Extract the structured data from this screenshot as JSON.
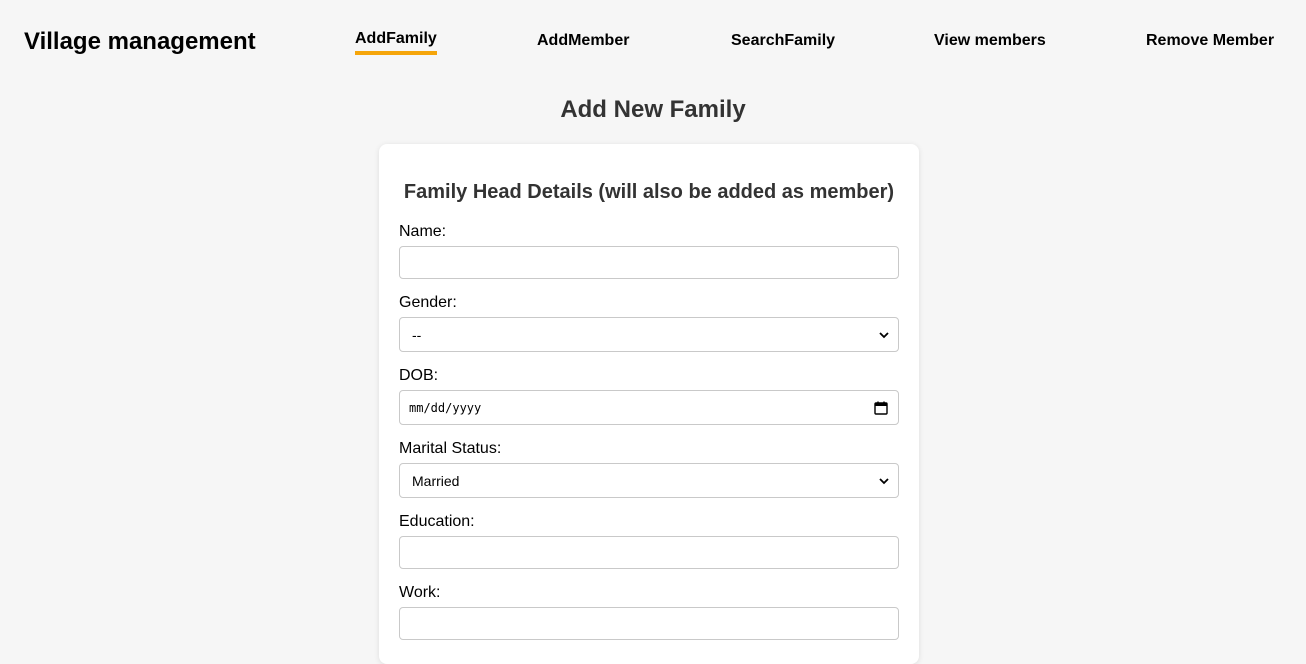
{
  "header": {
    "brand": "Village management",
    "nav": [
      {
        "label": "AddFamily",
        "active": true
      },
      {
        "label": "AddMember",
        "active": false
      },
      {
        "label": "SearchFamily",
        "active": false
      },
      {
        "label": "View members",
        "active": false
      },
      {
        "label": "Remove Member",
        "active": false
      }
    ],
    "active_color": "#f5a50a"
  },
  "page": {
    "title": "Add New Family"
  },
  "form": {
    "section_heading": "Family Head Details (will also be added as member)",
    "name": {
      "label": "Name:",
      "value": ""
    },
    "gender": {
      "label": "Gender:",
      "selected": "--"
    },
    "dob": {
      "label": "DOB:",
      "placeholder": "mm/dd/yyyy",
      "icon": "calendar-icon"
    },
    "marital_status": {
      "label": "Marital Status:",
      "selected": "Married"
    },
    "education": {
      "label": "Education:",
      "value": ""
    },
    "work": {
      "label": "Work:",
      "value": ""
    }
  }
}
